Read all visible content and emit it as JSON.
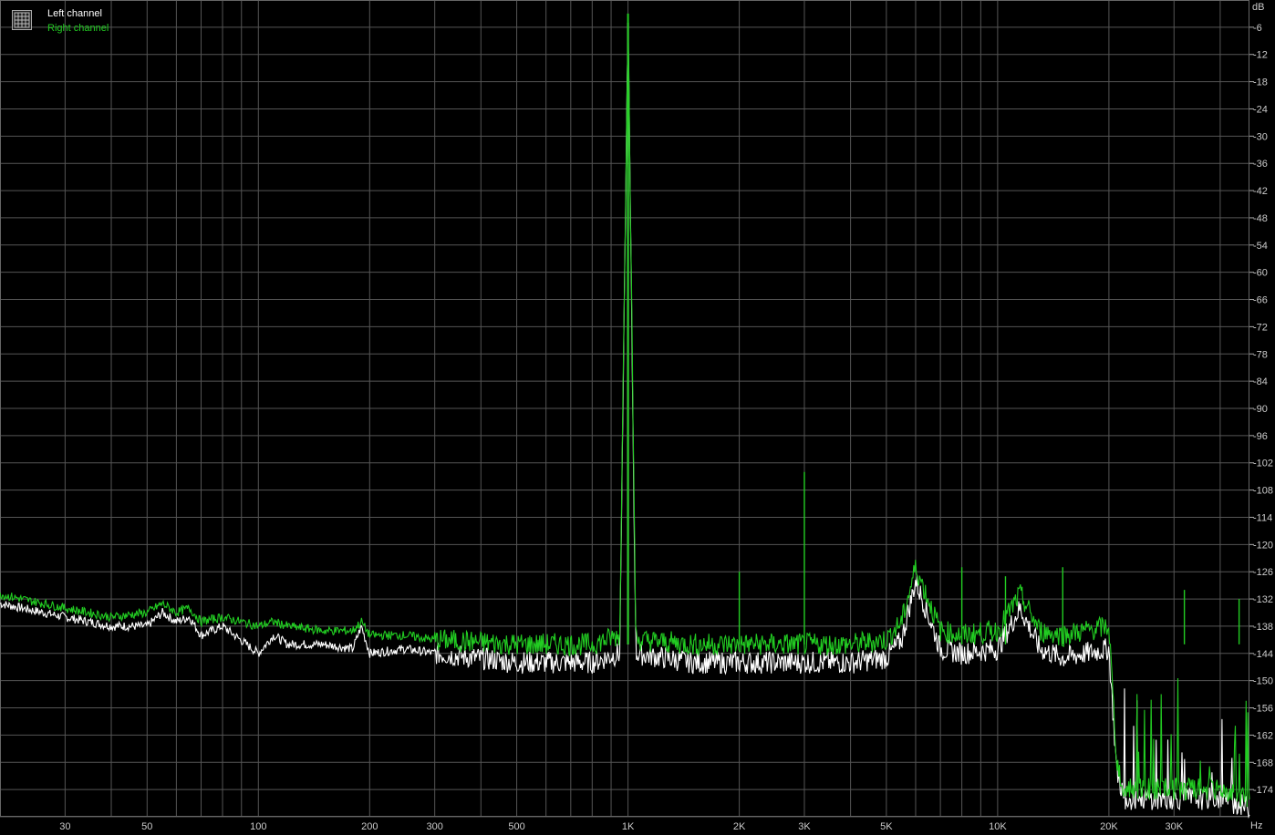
{
  "legend": {
    "icon": "grid-icon",
    "items": [
      {
        "label": "Left channel",
        "color": "#ffffff"
      },
      {
        "label": "Right channel",
        "color": "#22cc22"
      }
    ]
  },
  "axes": {
    "y_unit": "dB",
    "x_unit": "Hz",
    "y_ticks": [
      "-6",
      "-12",
      "-18",
      "-24",
      "-30",
      "-36",
      "-42",
      "-48",
      "-54",
      "-60",
      "-66",
      "-72",
      "-78",
      "-84",
      "-90",
      "-96",
      "-102",
      "-108",
      "-114",
      "-120",
      "-126",
      "-132",
      "-138",
      "-144",
      "-150",
      "-156",
      "-162",
      "-168",
      "-174"
    ],
    "x_ticks": [
      "30",
      "50",
      "100",
      "200",
      "300",
      "500",
      "1K",
      "2K",
      "3K",
      "5K",
      "10K",
      "20K",
      "30K"
    ]
  },
  "chart_data": {
    "type": "line",
    "title": "",
    "xlabel": "Hz",
    "ylabel": "dB",
    "x_scale": "log",
    "xlim": [
      20,
      48000
    ],
    "ylim": [
      -180,
      0
    ],
    "grid": true,
    "legend_position": "top-left",
    "series": [
      {
        "name": "Left channel",
        "color": "#ffffff",
        "x": [
          20,
          30,
          40,
          50,
          55,
          60,
          65,
          70,
          80,
          100,
          110,
          120,
          150,
          180,
          190,
          200,
          250,
          300,
          500,
          800,
          950,
          1000,
          1050,
          1500,
          2000,
          3000,
          4000,
          5000,
          5500,
          6000,
          7000,
          8000,
          10000,
          11500,
          13000,
          15000,
          20000,
          21000,
          22000,
          25000,
          30000,
          40000,
          48000
        ],
        "values": [
          -133,
          -136,
          -138,
          -138,
          -135,
          -137,
          -136,
          -140,
          -138,
          -144,
          -140,
          -142,
          -142,
          -143,
          -138,
          -144,
          -143,
          -144,
          -146,
          -146,
          -144,
          -5,
          -144,
          -146,
          -146,
          -146,
          -146,
          -145,
          -141,
          -128,
          -143,
          -144,
          -143,
          -134,
          -143,
          -145,
          -143,
          -170,
          -176,
          -176,
          -176,
          -176,
          -178
        ]
      },
      {
        "name": "Right channel",
        "color": "#22cc22",
        "x": [
          20,
          30,
          40,
          50,
          55,
          60,
          65,
          70,
          80,
          100,
          110,
          120,
          150,
          180,
          190,
          200,
          250,
          300,
          500,
          800,
          950,
          1000,
          1050,
          1500,
          2000,
          3000,
          4000,
          5000,
          5500,
          6000,
          7000,
          8000,
          10000,
          11500,
          13000,
          15000,
          20000,
          21000,
          22000,
          25000,
          30000,
          40000,
          48000
        ],
        "values": [
          -131,
          -134,
          -136,
          -135,
          -133,
          -135,
          -134,
          -137,
          -136,
          -138,
          -137,
          -138,
          -139,
          -139,
          -137,
          -140,
          -140,
          -141,
          -142,
          -142,
          -140,
          -3,
          -141,
          -142,
          -142,
          -142,
          -142,
          -141,
          -137,
          -125,
          -139,
          -140,
          -139,
          -131,
          -139,
          -140,
          -138,
          -168,
          -174,
          -174,
          -174,
          -174,
          -176
        ]
      }
    ],
    "peaks_right": [
      {
        "x": 2000,
        "y": -126
      },
      {
        "x": 3000,
        "y": -104
      },
      {
        "x": 8000,
        "y": -125
      },
      {
        "x": 10500,
        "y": -127
      },
      {
        "x": 15000,
        "y": -125
      },
      {
        "x": 32000,
        "y": -130
      },
      {
        "x": 45000,
        "y": -132
      }
    ]
  }
}
